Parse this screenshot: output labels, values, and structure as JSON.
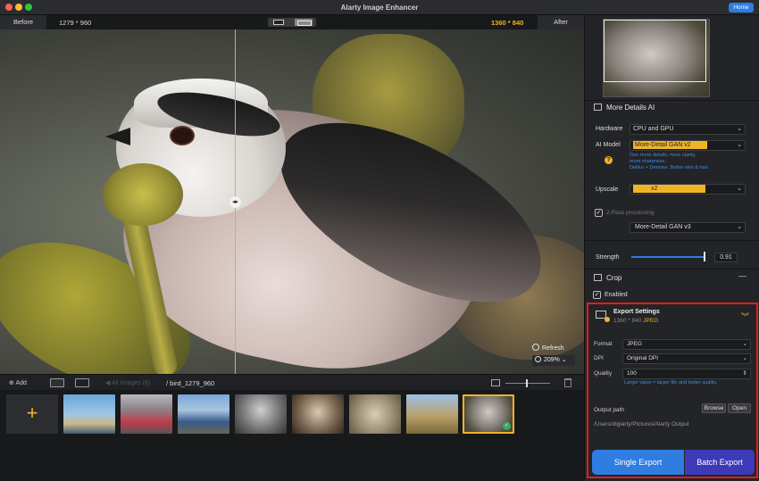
{
  "window": {
    "title": "Alarty Image Enhancer",
    "home_label": "Home"
  },
  "compare": {
    "before_label": "Before",
    "before_size": "1279 * 960",
    "after_size": "1360 * 840",
    "after_label": "After"
  },
  "canvas": {
    "refresh_label": "Refresh",
    "zoom": "209%"
  },
  "toolbar": {
    "add_label": "Add",
    "all_images_label": "All Images (8)",
    "breadcrumb": "/ bird_1279_960"
  },
  "thumbnails": [
    {
      "name": "beach-palm"
    },
    {
      "name": "street-people"
    },
    {
      "name": "cars-road"
    },
    {
      "name": "woman-outdoor"
    },
    {
      "name": "vintage-portrait"
    },
    {
      "name": "cat"
    },
    {
      "name": "woman-field"
    },
    {
      "name": "bird",
      "selected": true
    }
  ],
  "panel": {
    "more_details_title": "More Details AI",
    "hardware_label": "Hardware",
    "hardware_value": "CPU and GPU",
    "ai_model_label": "AI Model",
    "ai_model_value": "More-Detail GAN  v2",
    "ai_model_hint1": "Gen more details, more clarity,",
    "ai_model_hint2": "more sharpness.",
    "ai_model_hint3": "Deblur + Denoise. Better skin & hair.",
    "upscale_label": "Upscale",
    "upscale_value": "x2",
    "two_pass_label": "2-Pass processing",
    "two_pass_model": "More-Detail GAN  v3",
    "strength_label": "Strength",
    "strength_value": "0.91",
    "crop_title": "Crop",
    "crop_enabled_label": "Enabled"
  },
  "export": {
    "title": "Export Settings",
    "size": "1360 * 840",
    "format_badge": "JPEG",
    "format_label": "Format",
    "format_value": "JPEG",
    "dpi_label": "DPI",
    "dpi_value": "Original DPI",
    "quality_label": "Quality",
    "quality_value": "100",
    "quality_hint": "Larger value = larger file and better quality.",
    "output_label": "Output path",
    "browse_label": "Browse",
    "open_label": "Open",
    "output_path": "/Users/digiarty/Pictures/Alarty Output",
    "single_export_label": "Single Export",
    "batch_export_label": "Batch Export"
  },
  "colors": {
    "accent_yellow": "#f0b429",
    "accent_blue": "#2f7de1",
    "batch_purple": "#3d3ab8",
    "highlight_red": "#e0201b"
  }
}
